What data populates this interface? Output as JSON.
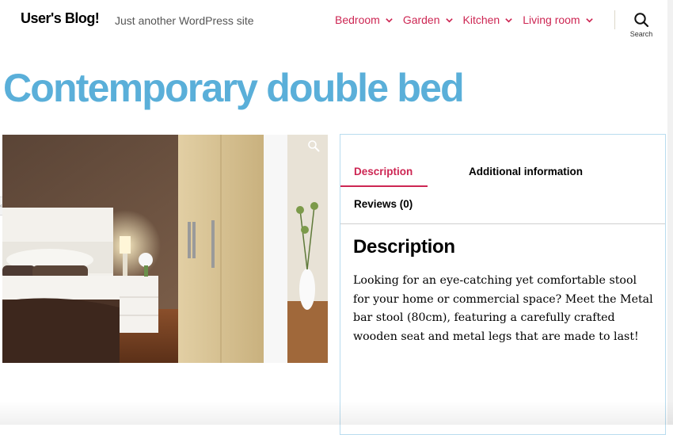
{
  "site": {
    "title": "User's Blog!",
    "tagline": "Just another WordPress site"
  },
  "nav": {
    "items": [
      {
        "label": "Bedroom"
      },
      {
        "label": "Garden"
      },
      {
        "label": "Kitchen"
      },
      {
        "label": "Living room"
      }
    ],
    "search_label": "Search"
  },
  "product": {
    "title": "Contemporary double bed"
  },
  "tabs": {
    "description": "Description",
    "additional_information": "Additional information",
    "reviews": "Reviews (0)",
    "active": "description"
  },
  "panel": {
    "heading": "Description",
    "body": "Looking for an eye-catching yet comfortable stool for your home or commercial space? Meet the Metal bar stool (80cm), featuring a carefully crafted wooden seat and metal legs that are made to last!"
  },
  "colors": {
    "accent": "#cd2653",
    "title": "#5aafd9",
    "panel_border": "#b9dcef"
  },
  "icons": [
    "chevron-down-icon",
    "search-icon",
    "zoom-icon"
  ]
}
